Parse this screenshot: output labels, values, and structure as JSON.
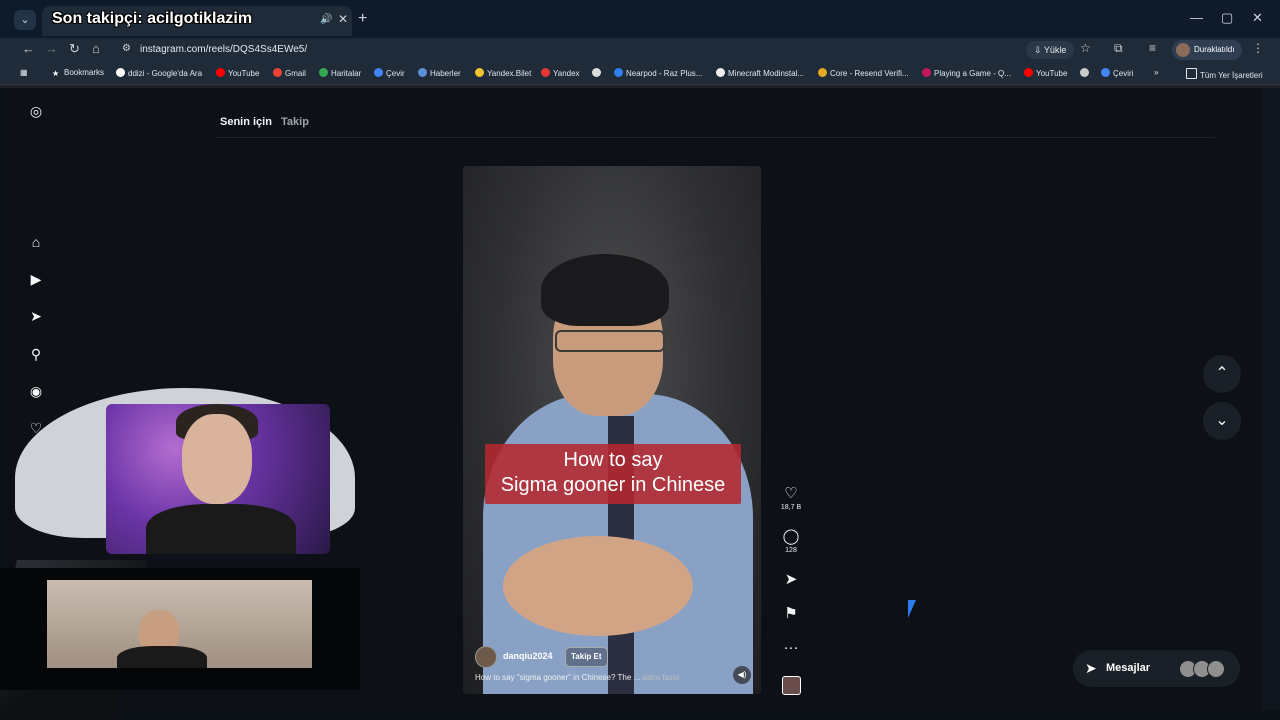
{
  "browser": {
    "tab_title": "Son takipçi: acilgotiklazim",
    "url": "instagram.com/reels/DQS4Ss4EWe5/",
    "install_label": "Yükle",
    "profile_label": "Duraklatıldı",
    "bookmarks": [
      "Bookmarks",
      "ddizi - Google'da Ara",
      "YouTube",
      "Gmail",
      "Haritalar",
      "Çevir",
      "Haberler",
      "Yandex.Bilet",
      "Yandex",
      "",
      "Nearpod - Raz Plus...",
      "Minecraft Modinstal...",
      "Core - Resend Verifi...",
      "Playing a Game - Q...",
      "YouTube",
      "",
      "Çeviri"
    ],
    "all_bookmarks": "Tüm Yer İşaretleri"
  },
  "feed": {
    "tab_for_you": "Senin için",
    "tab_following": "Takip"
  },
  "reel": {
    "caption_line1": "How to say",
    "caption_line2": "Sigma gooner in Chinese",
    "author": "danqiu2024",
    "follow_label": "Takip Et",
    "description": "How to say \"sigma gooner\" in Chinese? The ...",
    "more_label": "daha fazla",
    "likes": "18,7 B",
    "comments": "128"
  },
  "messages": {
    "label": "Mesajlar"
  },
  "icons": {
    "accent": "#2b7de9"
  }
}
